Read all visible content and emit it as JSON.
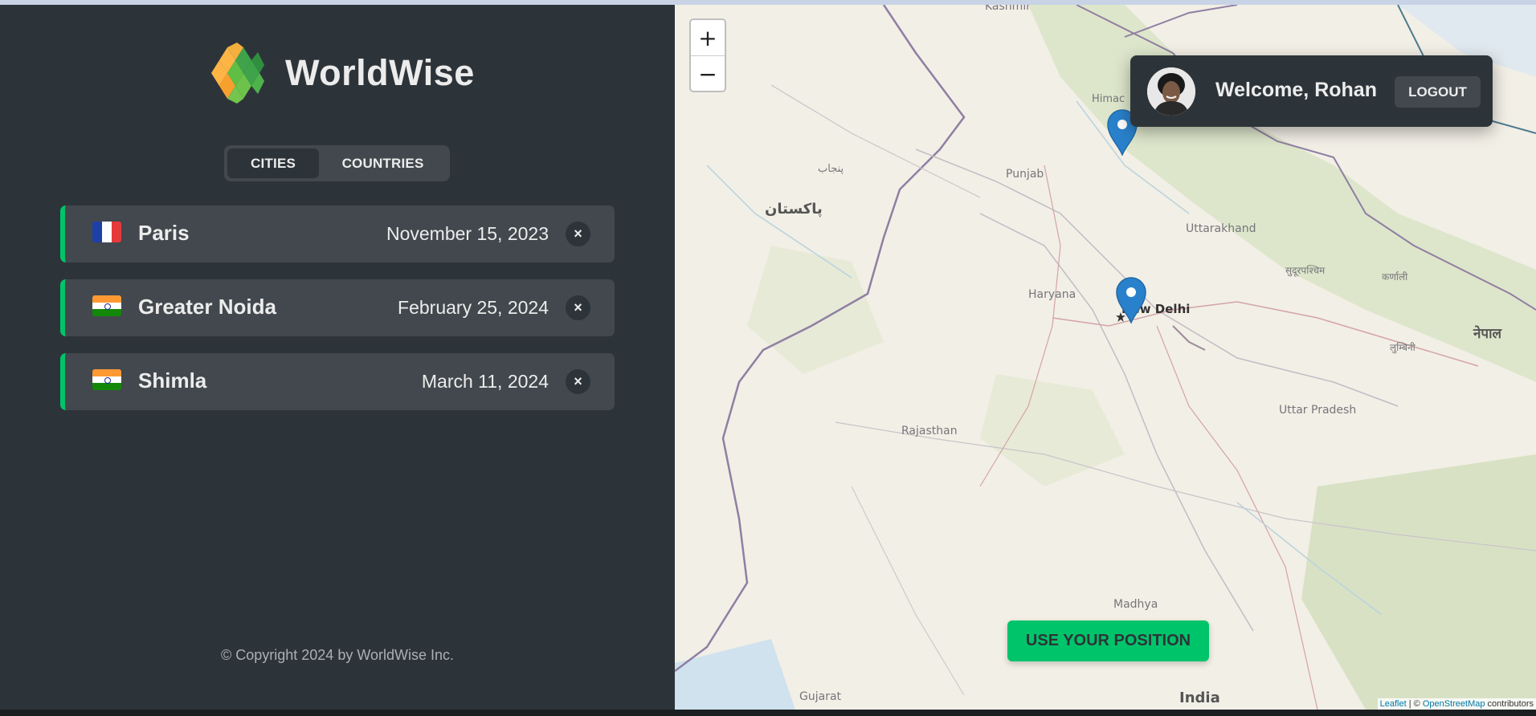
{
  "app": {
    "brand": "WorldWise",
    "accent": "#00c46a",
    "dark": "#2d3439",
    "panel": "#42484d"
  },
  "tabs": [
    {
      "label": "CITIES",
      "active": true
    },
    {
      "label": "COUNTRIES",
      "active": false
    }
  ],
  "cities": [
    {
      "flag": "fr-flag-icon",
      "name": "Paris",
      "date": "November 15, 2023"
    },
    {
      "flag": "in-flag-icon",
      "name": "Greater Noida",
      "date": "February 25, 2024"
    },
    {
      "flag": "in-flag-icon",
      "name": "Shimla",
      "date": "March 11, 2024"
    }
  ],
  "delete_glyph": "×",
  "footer": "© Copyright 2024 by WorldWise Inc.",
  "map": {
    "zoom_in": "+",
    "zoom_out": "−",
    "labels": {
      "kashmir": "Kashmir",
      "himachal": "Himac",
      "punjab": "Punjab",
      "punjab_urdu": "پنجاب",
      "pakistan": "پاکستان",
      "uttarakhand": "Uttarakhand",
      "haryana": "Haryana",
      "new_delhi": "New Delhi",
      "nepal_1": "सुदूरपश्चिम",
      "nepal_2": "कर्णाली",
      "nepal_3": "नेपाल",
      "nepal_4": "लुम्बिनी",
      "rajasthan": "Rajasthan",
      "uttar_pradesh": "Uttar Pradesh",
      "madhya": "Madhya",
      "gujarat": "Gujarat",
      "india": "India"
    },
    "attribution_leaflet": "Leaflet",
    "attribution_sep": " | © ",
    "attribution_osm": "OpenStreetMap",
    "attribution_tail": " contributors"
  },
  "user": {
    "welcome": "Welcome, Rohan",
    "logout": "LOGOUT"
  },
  "use_position": "USE YOUR POSITION"
}
